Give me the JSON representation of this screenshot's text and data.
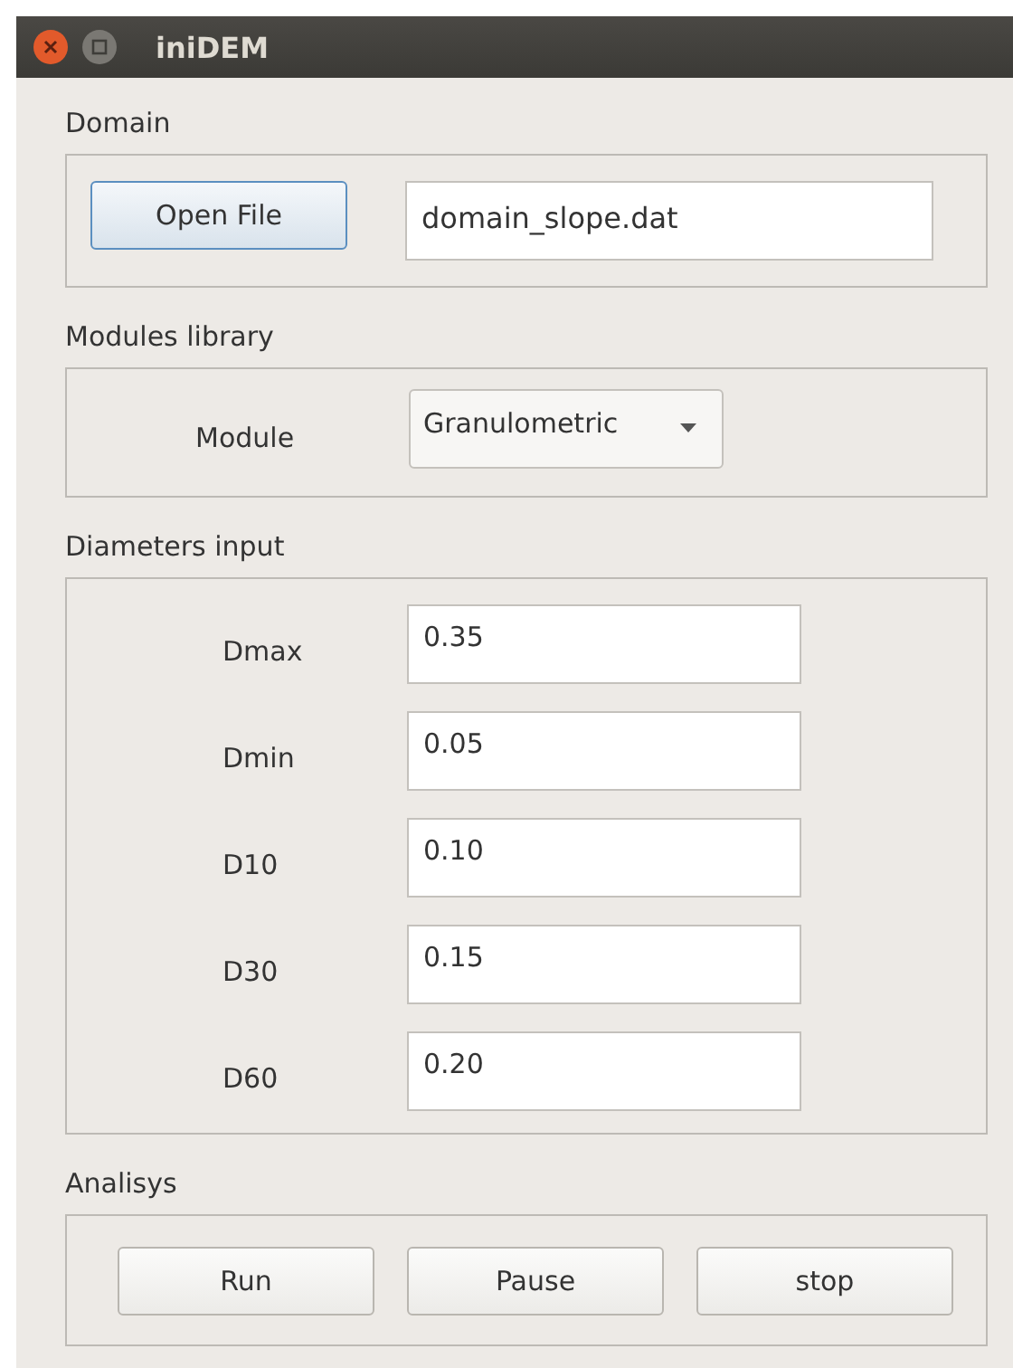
{
  "window": {
    "title": "iniDEM"
  },
  "domain": {
    "title": "Domain",
    "button": {
      "label": "Open File",
      "focused": true
    },
    "file_field": {
      "value": "domain_slope.dat"
    }
  },
  "modules": {
    "title": "Modules library",
    "label": "Module",
    "dropdown": {
      "value": "Granulometric"
    }
  },
  "diameters": {
    "title": "Diameters input",
    "fields": [
      {
        "label": "Dmax",
        "value": "0.35"
      },
      {
        "label": "Dmin",
        "value": "0.05"
      },
      {
        "label": "D10",
        "value": "0.10"
      },
      {
        "label": "D30",
        "value": "0.15"
      },
      {
        "label": "D60",
        "value": "0.20"
      }
    ]
  },
  "analysis": {
    "title": "Analisys",
    "buttons": [
      "Run",
      "Pause",
      "stop"
    ]
  }
}
